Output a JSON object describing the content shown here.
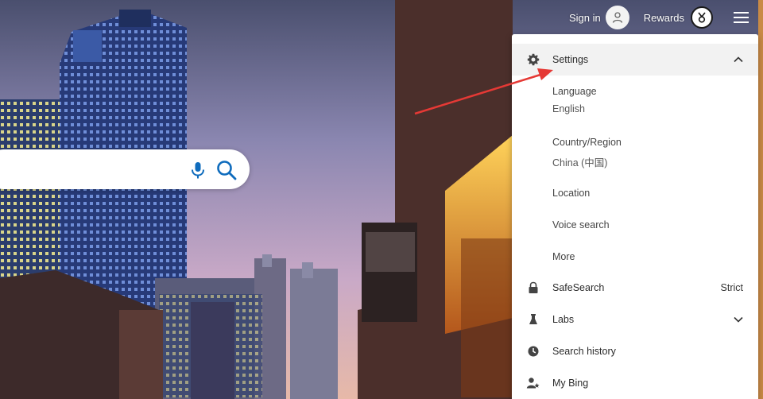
{
  "header": {
    "signin_label": "Sign in",
    "rewards_label": "Rewards"
  },
  "search": {
    "value": "",
    "placeholder": ""
  },
  "settings_menu": {
    "settings_label": "Settings",
    "language": {
      "label": "Language",
      "value": "English"
    },
    "country": {
      "label": "Country/Region",
      "value": "China (中国)"
    },
    "location_label": "Location",
    "voice_search_label": "Voice search",
    "more_label": "More",
    "safesearch": {
      "label": "SafeSearch",
      "value": "Strict"
    },
    "labs_label": "Labs",
    "search_history_label": "Search history",
    "my_bing_label": "My Bing"
  },
  "icons": {
    "avatar": "person-icon",
    "rewards": "medal-icon",
    "menu": "hamburger-icon",
    "mic": "microphone-icon",
    "search": "magnifier-icon",
    "settings": "gear-icon",
    "safesearch": "lock-icon",
    "labs": "flask-icon",
    "history": "clock-icon",
    "mybing": "person-star-icon"
  },
  "colors": {
    "accent": "#0f6cbd",
    "annotation_arrow": "#e53935",
    "panel_highlight": "#f2f2f2"
  }
}
